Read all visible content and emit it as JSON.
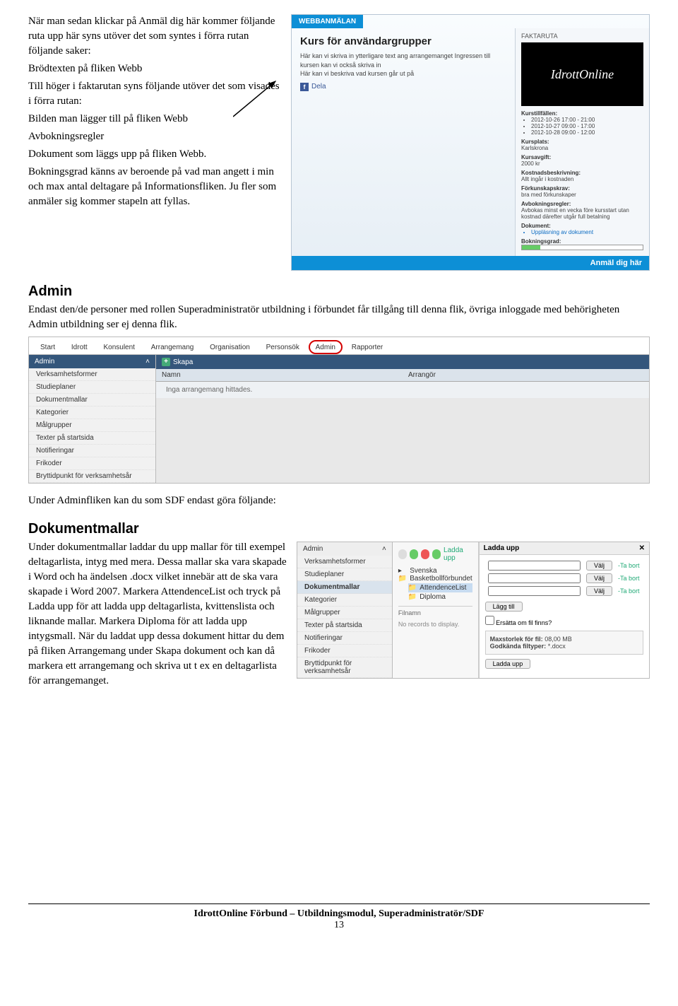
{
  "intro": {
    "lines": [
      "När man sedan klickar på Anmäl dig här kommer följande ruta upp här syns utöver det som syntes i förra rutan följande saker:",
      "Brödtexten på fliken Webb",
      "Till höger i faktarutan syns följande utöver det som visades i förra rutan:",
      "Bilden man lägger till på fliken Webb",
      "Avbokningsregler",
      "Dokument som läggs upp på fliken Webb.",
      "Bokningsgrad känns av beroende på vad man angett i min och max antal deltagare på Informationsfliken. Ju fler som anmäler sig kommer stapeln att fyllas."
    ]
  },
  "webbanmalan": {
    "tab": "WEBBANMÄLAN",
    "title": "Kurs för användargrupper",
    "desc1": "Här kan vi skriva in ytterligare text ang arrangemanget Ingressen till kursen kan vi också skriva in",
    "desc2": "Här kan vi beskriva vad kursen går ut på",
    "share": "Dela",
    "cta": "Anmäl dig här"
  },
  "faktaruta": {
    "title": "FAKTARUTA",
    "logo": "IdrottOnline",
    "kurstillfallen_label": "Kurstillfällen:",
    "kurstillfallen": [
      "2012-10-26 17:00 - 21:00",
      "2012-10-27 09:00 - 17:00",
      "2012-10-28 09:00 - 12:00"
    ],
    "kursplats_label": "Kursplats:",
    "kursplats": "Karlskrona",
    "kursavgift_label": "Kursavgift:",
    "kursavgift": "2000 kr",
    "kostnad_label": "Kostnadsbeskrivning:",
    "kostnad": "Allt ingår i kostnaden",
    "forkunskap_label": "Förkunskapskrav:",
    "forkunskap": "bra med förkunskaper",
    "avbok_label": "Avbokningsregler:",
    "avbok": "Avbokas minst en vecka före kursstart utan kostnad därefter utgår full betalning",
    "dokument_label": "Dokument:",
    "dokument": "Uppläsning av dokument",
    "bok_label": "Bokningsgrad:"
  },
  "admin": {
    "heading": "Admin",
    "para": "Endast den/de personer med rollen Superadministratör utbildning i förbundet får tillgång till denna flik, övriga inloggade med behörigheten Admin utbildning ser ej denna flik.",
    "tabs": [
      "Start",
      "Idrott",
      "Konsulent",
      "Arrangemang",
      "Organisation",
      "Personsök",
      "Admin",
      "Rapporter"
    ],
    "side_head": "Admin",
    "side_items": [
      "Verksamhetsformer",
      "Studieplaner",
      "Dokumentmallar",
      "Kategorier",
      "Målgrupper",
      "Texter på startsida",
      "Notifieringar",
      "Frikoder",
      "Bryttidpunkt för verksamhetsår"
    ],
    "main_bar": "Skapa",
    "col1": "Namn",
    "col2": "Arrangör",
    "empty": "Inga arrangemang hittades.",
    "after": "Under Adminfliken kan du som SDF endast göra följande:"
  },
  "dokmall": {
    "heading": "Dokumentmallar",
    "para1": "Under dokumentmallar laddar du upp mallar för till exempel deltagarlista, intyg med mera. Dessa mallar ska vara skapade i Word och ha ändelsen .docx vilket innebär att de ska vara skapade i Word 2007. Markera AttendenceList och tryck på Ladda upp för att ladda upp deltagarlista, kvittenslista och liknande mallar. Markera Diploma för att ladda upp intygsmall. När du laddat upp dessa dokument hittar du dem på fliken Arrangemang under Skapa dokument och kan då markera ett arrangemang och skriva ut t ex en deltagarlista för arrangemanget.",
    "side_head": "Admin",
    "side_sel": "Dokumentmallar",
    "ladda_upp": "Ladda upp",
    "tree_root": "Svenska Basketbollförbundet",
    "tree_sel": "AttendenceList",
    "tree_item": "Diploma",
    "filnamn": "Filnamn",
    "empty": "No records to display.",
    "upload_head": "Ladda upp",
    "valj": "Välj",
    "tabort": "-Ta bort",
    "lagg_till": "Lägg till",
    "ersatt": "Ersätta om fil finns?",
    "maxstorlek_l": "Maxstorlek för fil:",
    "maxstorlek_v": "08,00 MB",
    "godkanda_l": "Godkända filtyper:",
    "godkanda_v": "*.docx",
    "ladda_btn": "Ladda upp"
  },
  "footer": {
    "line": "IdrottOnline Förbund – Utbildningsmodul, Superadministratör/SDF",
    "page": "13"
  }
}
